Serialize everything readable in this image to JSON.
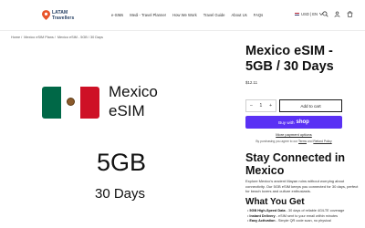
{
  "header": {
    "logo_line1": "LATAM",
    "logo_line2": "Travellers",
    "nav": [
      "e-SIMs",
      "Medi - Travel Planner",
      "How We Work",
      "Travel Guide",
      "About Us",
      "FAQs"
    ],
    "locale": "USD | EN"
  },
  "breadcrumb": {
    "items": [
      "Home",
      "Mexico eSIM Plans",
      "Mexico eSIM - 5GB / 30 Days"
    ]
  },
  "media": {
    "title_line1": "Mexico",
    "title_line2": "eSIM",
    "data_amount": "5GB",
    "duration": "30 Days",
    "flag_colors": [
      "#006847",
      "#ffffff",
      "#ce1126"
    ]
  },
  "product": {
    "title": "Mexico eSIM - 5GB / 30 Days",
    "price": "$12.11",
    "quantity": "1",
    "qty_minus": "–",
    "qty_plus": "+",
    "add_to_cart": "Add to cart",
    "buy_with": "Buy with",
    "shop": "shop",
    "shop_color": "#5a31f4",
    "more_payment": "More payment options",
    "agree_prefix": "By purchasing you agree to our",
    "terms": "Terms",
    "and": "and",
    "refund": "Refund Policy"
  },
  "description": {
    "heading": "Stay Connected in Mexico",
    "text": "Explore Mexico's ancient Mayan ruins without worrying about connectivity. Our 5GB eSIM keeps you connected for 30 days, perfect for beach lovers and culture enthusiasts.",
    "what_heading": "What You Get",
    "features": [
      {
        "label": "5GB High-Speed Data",
        "text": " - 30 days of reliable 4G/LTE coverage"
      },
      {
        "label": "Instant Delivery",
        "text": " - eSIM sent to your email within minutes"
      },
      {
        "label": "Easy Activation",
        "text": " - Simple QR code scan, no physical"
      }
    ]
  }
}
